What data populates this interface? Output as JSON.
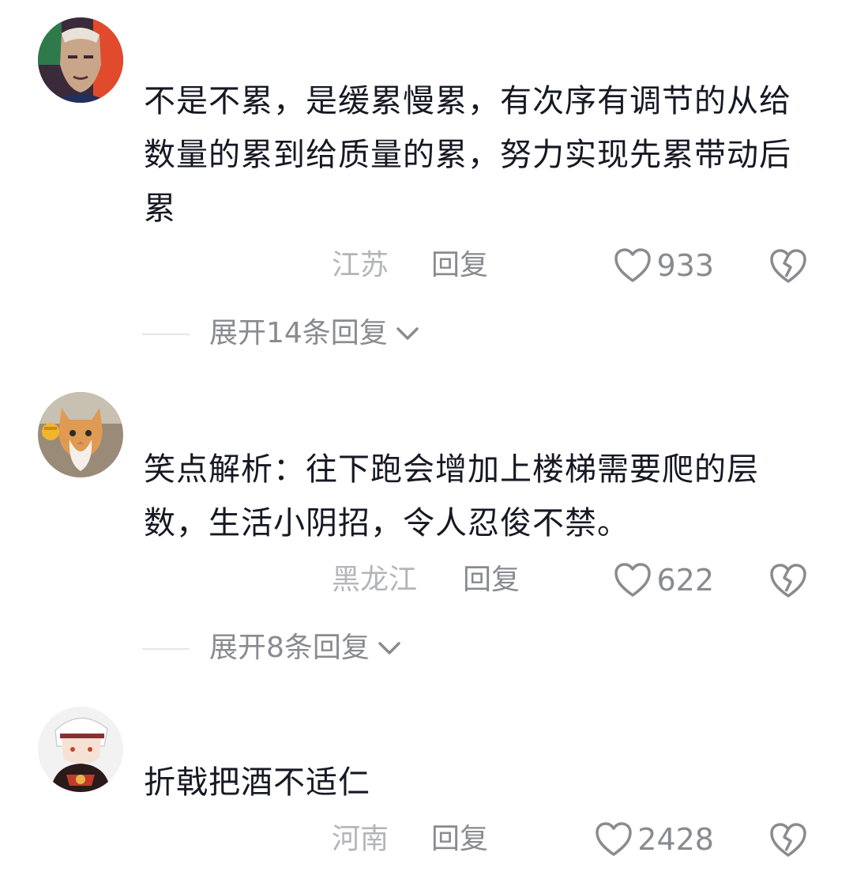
{
  "comments": [
    {
      "text": "不是不累，是缓累慢累，有次序有调节的从给数量的累到给质量的累，努力实现先累带动后累",
      "location": "江苏",
      "reply_label": "回复",
      "likes": "933",
      "expand_label": "展开14条回复",
      "avatar_icon": "avatar-man-portrait"
    },
    {
      "text": "笑点解析：往下跑会增加上楼梯需要爬的层数，生活小阴招，令人忍俊不禁。",
      "location": "黑龙江",
      "reply_label": "回复",
      "likes": "622",
      "expand_label": "展开8条回复",
      "avatar_icon": "avatar-cat-fist"
    },
    {
      "text": "折戟把酒不适仁",
      "location": "河南",
      "reply_label": "回复",
      "likes": "2428",
      "avatar_icon": "avatar-anime-character"
    }
  ],
  "colors": {
    "text_primary": "#161823",
    "text_secondary": "#8a8b91",
    "text_location": "#b4b5b9",
    "divider": "#e5e5e7"
  },
  "icons": {
    "like": "heart-outline-icon",
    "dislike": "broken-heart-icon",
    "expand": "chevron-down-icon"
  }
}
